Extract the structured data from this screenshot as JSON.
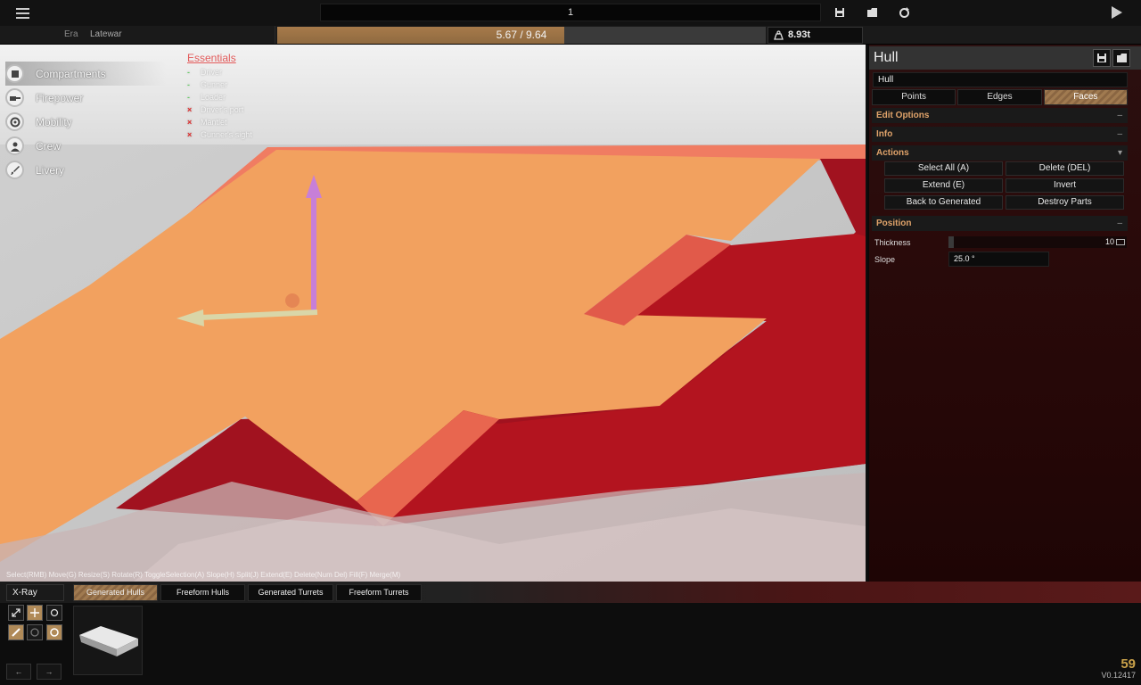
{
  "topbar": {
    "title": "1",
    "icons": [
      "menu-icon",
      "save-icon",
      "open-icon",
      "refresh-icon",
      "play-icon"
    ]
  },
  "statusbar": {
    "era_label": "Era",
    "era_value": "Latewar",
    "weight_text": "5.67 / 9.64",
    "weight_fraction": 0.588,
    "tonnage": "8.93t"
  },
  "categories": [
    {
      "label": "Compartments",
      "icon": "box-icon"
    },
    {
      "label": "Firepower",
      "icon": "gun-icon"
    },
    {
      "label": "Mobility",
      "icon": "wheel-icon"
    },
    {
      "label": "Crew",
      "icon": "person-icon"
    },
    {
      "label": "Livery",
      "icon": "brush-icon"
    }
  ],
  "essentials": {
    "title": "Essentials",
    "items": [
      {
        "label": "Driver",
        "mark": "-",
        "ok": true
      },
      {
        "label": "Gunner",
        "mark": "-",
        "ok": true
      },
      {
        "label": "Loader",
        "mark": "-",
        "ok": true
      },
      {
        "label": "Driver's port",
        "mark": "×",
        "ok": false
      },
      {
        "label": "Mantlet",
        "mark": "×",
        "ok": false
      },
      {
        "label": "Gunner's sight",
        "mark": "×",
        "ok": false
      }
    ]
  },
  "hint": "Select(RMB) Move(G) Resize(S) Rotate(R) ToggleSelection(A) Slope(H) Split(J) Extend(E) Delete(Num Del) Fill(F) Merge(M)",
  "panel": {
    "title": "Hull",
    "name_value": "Hull",
    "modes": [
      "Points",
      "Edges",
      "Faces"
    ],
    "active_mode": "Faces",
    "sections": {
      "edit_options": "Edit Options",
      "info": "Info",
      "actions": "Actions",
      "position": "Position"
    },
    "actions": [
      "Select All (A)",
      "Delete (DEL)",
      "Extend (E)",
      "Invert",
      "Back to Generated",
      "Destroy Parts"
    ],
    "thickness_label": "Thickness",
    "thickness_value": "10",
    "slope_label": "Slope",
    "slope_value": "25.0 °"
  },
  "bottom": {
    "xray": "X-Ray",
    "tabs": [
      "Generated Hulls",
      "Freeform Hulls",
      "Generated Turrets",
      "Freeform Turrets"
    ],
    "active_tab": "Generated Hulls",
    "undo": "←",
    "redo": "→",
    "fps": "59",
    "version": "V0.12417"
  },
  "colors": {
    "accent": "#a77a4a",
    "section_text": "#e0a36a",
    "panel_bg": "#2a0b0b",
    "hull_face": "#f2a15f",
    "hull_red": "#a1121f"
  }
}
